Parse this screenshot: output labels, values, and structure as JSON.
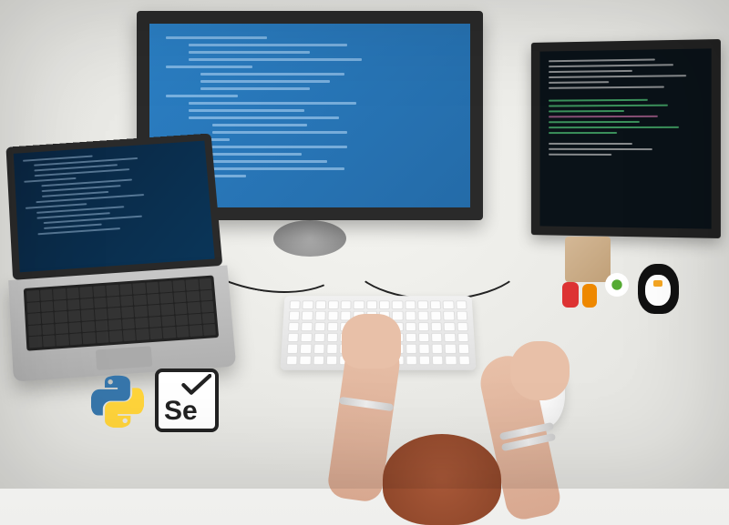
{
  "logos": {
    "python": "Python",
    "selenium_text": "Se"
  }
}
